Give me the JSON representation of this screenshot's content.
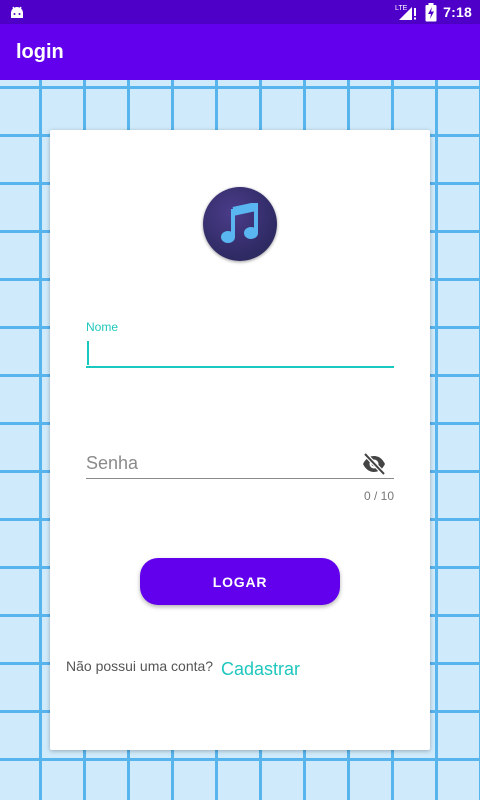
{
  "status_bar": {
    "network_label": "LTE",
    "time": "7:18",
    "icons": [
      "android-icon",
      "signal-icon",
      "battery-charging-icon"
    ]
  },
  "app_bar": {
    "title": "login"
  },
  "form": {
    "logo_icon": "music-note-icon",
    "name_field": {
      "label": "Nome",
      "value": ""
    },
    "password_field": {
      "placeholder": "Senha",
      "value": "",
      "counter": "0 / 10",
      "toggle_icon": "eye-off-icon"
    },
    "login_button": "LOGAR",
    "no_account_text": "Não possui uma conta?",
    "register_link": "Cadastrar"
  },
  "colors": {
    "primary": "#6200ee",
    "status_bar": "#4f00c8",
    "accent": "#1fc7be",
    "grid_background": "#cfeafb",
    "grid_lines": "#57b4ec"
  }
}
